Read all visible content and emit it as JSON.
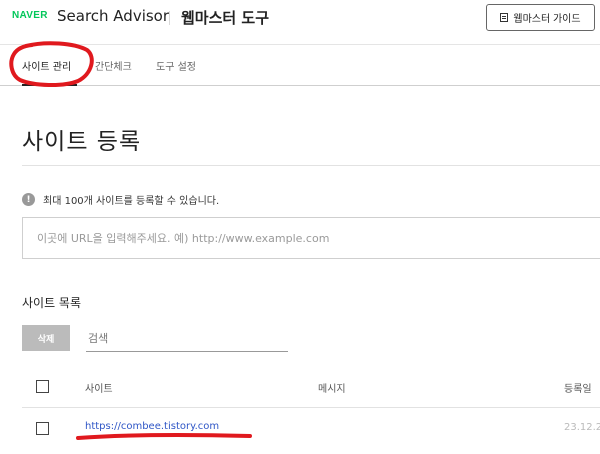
{
  "header": {
    "logo": "NAVER",
    "app_name": "Search Advisor",
    "tool_title": "웹마스터 도구",
    "guide_button": {
      "label": "웹마스터 가이드",
      "icon": "document-icon"
    }
  },
  "tabs": [
    {
      "label": "사이트 관리",
      "active": true
    },
    {
      "label": "간단체크",
      "active": false
    },
    {
      "label": "도구 설정",
      "active": false
    }
  ],
  "main": {
    "title": "사이트 등록",
    "info_text": "최대 100개 사이트를 등록할 수 있습니다.",
    "url_input": {
      "placeholder": "이곳에 URL을 입력해주세요. 예) http://www.example.com",
      "value": ""
    },
    "site_list": {
      "title": "사이트 목록",
      "delete_label": "삭제",
      "search_placeholder": "검색",
      "columns": [
        "사이트",
        "메시지",
        "등록일"
      ],
      "rows": [
        {
          "site": "https://combee.tistory.com",
          "message": "",
          "date": "23.12.2"
        }
      ]
    }
  },
  "colors": {
    "naver_green": "#03c75a",
    "link_blue": "#2f56c6",
    "annotation_red": "#e0191e",
    "disabled_button": "#bbbbbb"
  }
}
